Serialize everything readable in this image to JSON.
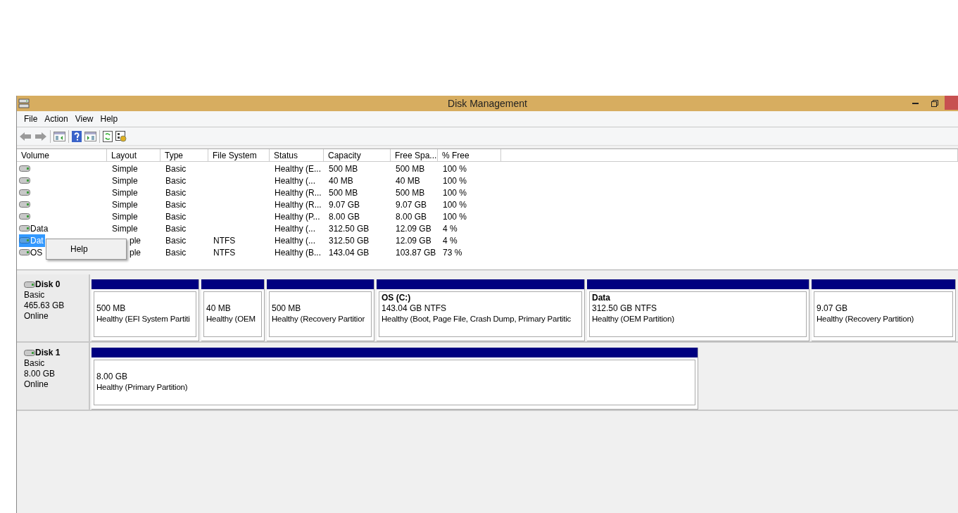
{
  "window": {
    "title": "Disk Management"
  },
  "menu": [
    "File",
    "Action",
    "View",
    "Help"
  ],
  "table": {
    "columns": [
      "Volume",
      "Layout",
      "Type",
      "File System",
      "Status",
      "Capacity",
      "Free Spa...",
      "% Free"
    ],
    "rows": [
      {
        "volume": "",
        "layout": "Simple",
        "type": "Basic",
        "file_system": "",
        "status": "Healthy (E...",
        "capacity": "500 MB",
        "free_space": "500 MB",
        "percent_free": "100 %",
        "selected": false,
        "obscured": false
      },
      {
        "volume": "",
        "layout": "Simple",
        "type": "Basic",
        "file_system": "",
        "status": "Healthy (...",
        "capacity": "40 MB",
        "free_space": "40 MB",
        "percent_free": "100 %",
        "selected": false,
        "obscured": false
      },
      {
        "volume": "",
        "layout": "Simple",
        "type": "Basic",
        "file_system": "",
        "status": "Healthy (R...",
        "capacity": "500 MB",
        "free_space": "500 MB",
        "percent_free": "100 %",
        "selected": false,
        "obscured": false
      },
      {
        "volume": "",
        "layout": "Simple",
        "type": "Basic",
        "file_system": "",
        "status": "Healthy (R...",
        "capacity": "9.07 GB",
        "free_space": "9.07 GB",
        "percent_free": "100 %",
        "selected": false,
        "obscured": false
      },
      {
        "volume": "",
        "layout": "Simple",
        "type": "Basic",
        "file_system": "",
        "status": "Healthy (P...",
        "capacity": "8.00 GB",
        "free_space": "8.00 GB",
        "percent_free": "100 %",
        "selected": false,
        "obscured": false
      },
      {
        "volume": "Data",
        "layout": "Simple",
        "type": "Basic",
        "file_system": "",
        "status": "Healthy (...",
        "capacity": "312.50 GB",
        "free_space": "12.09 GB",
        "percent_free": "4 %",
        "selected": false,
        "obscured": false
      },
      {
        "volume": "Dat",
        "layout": "ple",
        "type": "Basic",
        "file_system": "NTFS",
        "status": "Healthy (...",
        "capacity": "312.50 GB",
        "free_space": "12.09 GB",
        "percent_free": "4 %",
        "selected": true,
        "obscured": true
      },
      {
        "volume": "OS",
        "layout": "ple",
        "type": "Basic",
        "file_system": "NTFS",
        "status": "Healthy (B...",
        "capacity": "143.04 GB",
        "free_space": "103.87 GB",
        "percent_free": "73 %",
        "selected": false,
        "obscured": true
      }
    ]
  },
  "context_menu": {
    "items": [
      "Help"
    ]
  },
  "disks": [
    {
      "name": "Disk 0",
      "type": "Basic",
      "size": "465.63 GB",
      "status": "Online",
      "partitions": [
        {
          "size": "500 MB",
          "status": "Healthy (EFI System Partiti"
        },
        {
          "size": "40 MB",
          "status": "Healthy (OEM"
        },
        {
          "size": "500 MB",
          "status": "Healthy (Recovery Partitior"
        },
        {
          "label": "OS  (C:)",
          "size": "143.04 GB NTFS",
          "status": "Healthy (Boot, Page File, Crash Dump, Primary Partitic"
        },
        {
          "label": "Data",
          "size": "312.50 GB NTFS",
          "status": "Healthy (OEM Partition)"
        },
        {
          "size": "9.07 GB",
          "status": "Healthy (Recovery Partition)"
        }
      ]
    },
    {
      "name": "Disk 1",
      "type": "Basic",
      "size": "8.00 GB",
      "status": "Online",
      "partitions": [
        {
          "size": "8.00 GB",
          "status": "Healthy (Primary Partition)"
        }
      ]
    }
  ]
}
